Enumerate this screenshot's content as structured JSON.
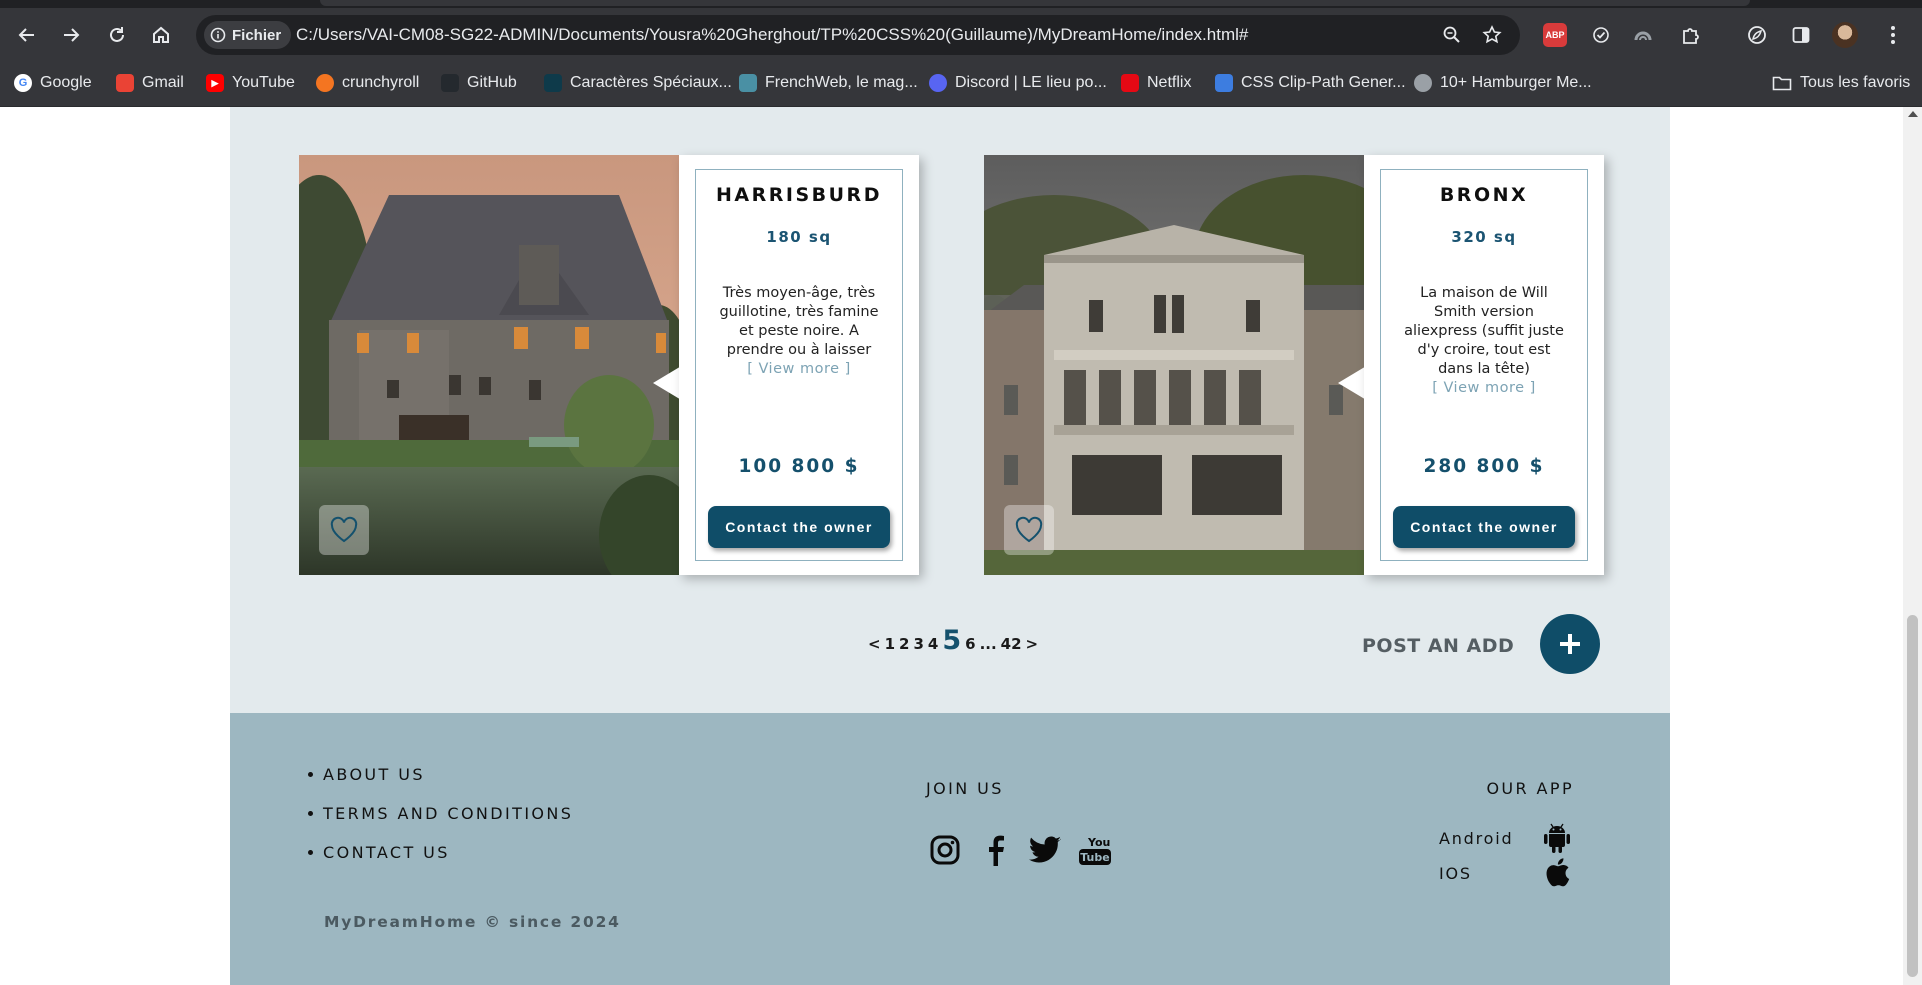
{
  "browser": {
    "chip_label": "Fichier",
    "url": "C:/Users/VAI-CM08-SG22-ADMIN/Documents/Yousra%20Gherghout/TP%20CSS%20(Guillaume)/MyDreamHome/index.html#",
    "abp_label": "ABP",
    "bookmarks": [
      {
        "label": "Google",
        "icon": "google-icon",
        "color": "#ffffff"
      },
      {
        "label": "Gmail",
        "icon": "gmail-icon",
        "color": "#ea4335"
      },
      {
        "label": "YouTube",
        "icon": "youtube-icon",
        "color": "#ff0000"
      },
      {
        "label": "crunchyroll",
        "icon": "crunchyroll-icon",
        "color": "#f47521"
      },
      {
        "label": "GitHub",
        "icon": "github-icon",
        "color": "#24292e"
      },
      {
        "label": "Caractères Spéciaux...",
        "icon": "caracteres-icon",
        "color": "#0e3a4a"
      },
      {
        "label": "FrenchWeb, le mag...",
        "icon": "frenchweb-icon",
        "color": "#4a90a4"
      },
      {
        "label": "Discord | LE lieu po...",
        "icon": "discord-icon",
        "color": "#5865f2"
      },
      {
        "label": "Netflix",
        "icon": "netflix-icon",
        "color": "#e50914"
      },
      {
        "label": "CSS Clip-Path Gener...",
        "icon": "clippath-icon",
        "color": "#3d7de0"
      },
      {
        "label": "10+ Hamburger Me...",
        "icon": "globe-icon",
        "color": "#9aa0a6"
      }
    ],
    "all_bookmarks": "Tous les favoris"
  },
  "listings": [
    {
      "city": "HARRISBURD",
      "area": "180 sq",
      "description": "Très moyen-âge, très guillotine, très famine et peste noire. A prendre ou à laisser",
      "view_more": "[ View more ]",
      "price": "100 800 $",
      "contact_label": "Contact the owner"
    },
    {
      "city": "BRONX",
      "area": "320 sq",
      "description": "La maison de Will Smith version aliexpress (suffit juste d'y croire, tout est dans la tête)",
      "view_more": "[ View more ]",
      "price": "280 800 $",
      "contact_label": "Contact the owner"
    }
  ],
  "pagination": {
    "prev": "<",
    "pages_before": [
      "1",
      "2",
      "3",
      "4"
    ],
    "current": "5",
    "pages_after": [
      "6"
    ],
    "ellipsis": "...",
    "last": "42",
    "next": ">"
  },
  "post_add": {
    "label": "POST AN ADD",
    "symbol": "+"
  },
  "footer": {
    "links": [
      "ABOUT US",
      "TERMS AND CONDITIONS",
      "CONTACT US"
    ],
    "copyright": "MyDreamHome © since 2024",
    "join_title": "JOIN US",
    "youtube_text": [
      "You",
      "Tube"
    ],
    "app_title": "OUR APP",
    "apps": [
      "Android",
      "IOS"
    ]
  },
  "colors": {
    "accent": "#0f4d68",
    "listing_bg": "#e3eaed",
    "footer_bg": "#9db7c1"
  }
}
